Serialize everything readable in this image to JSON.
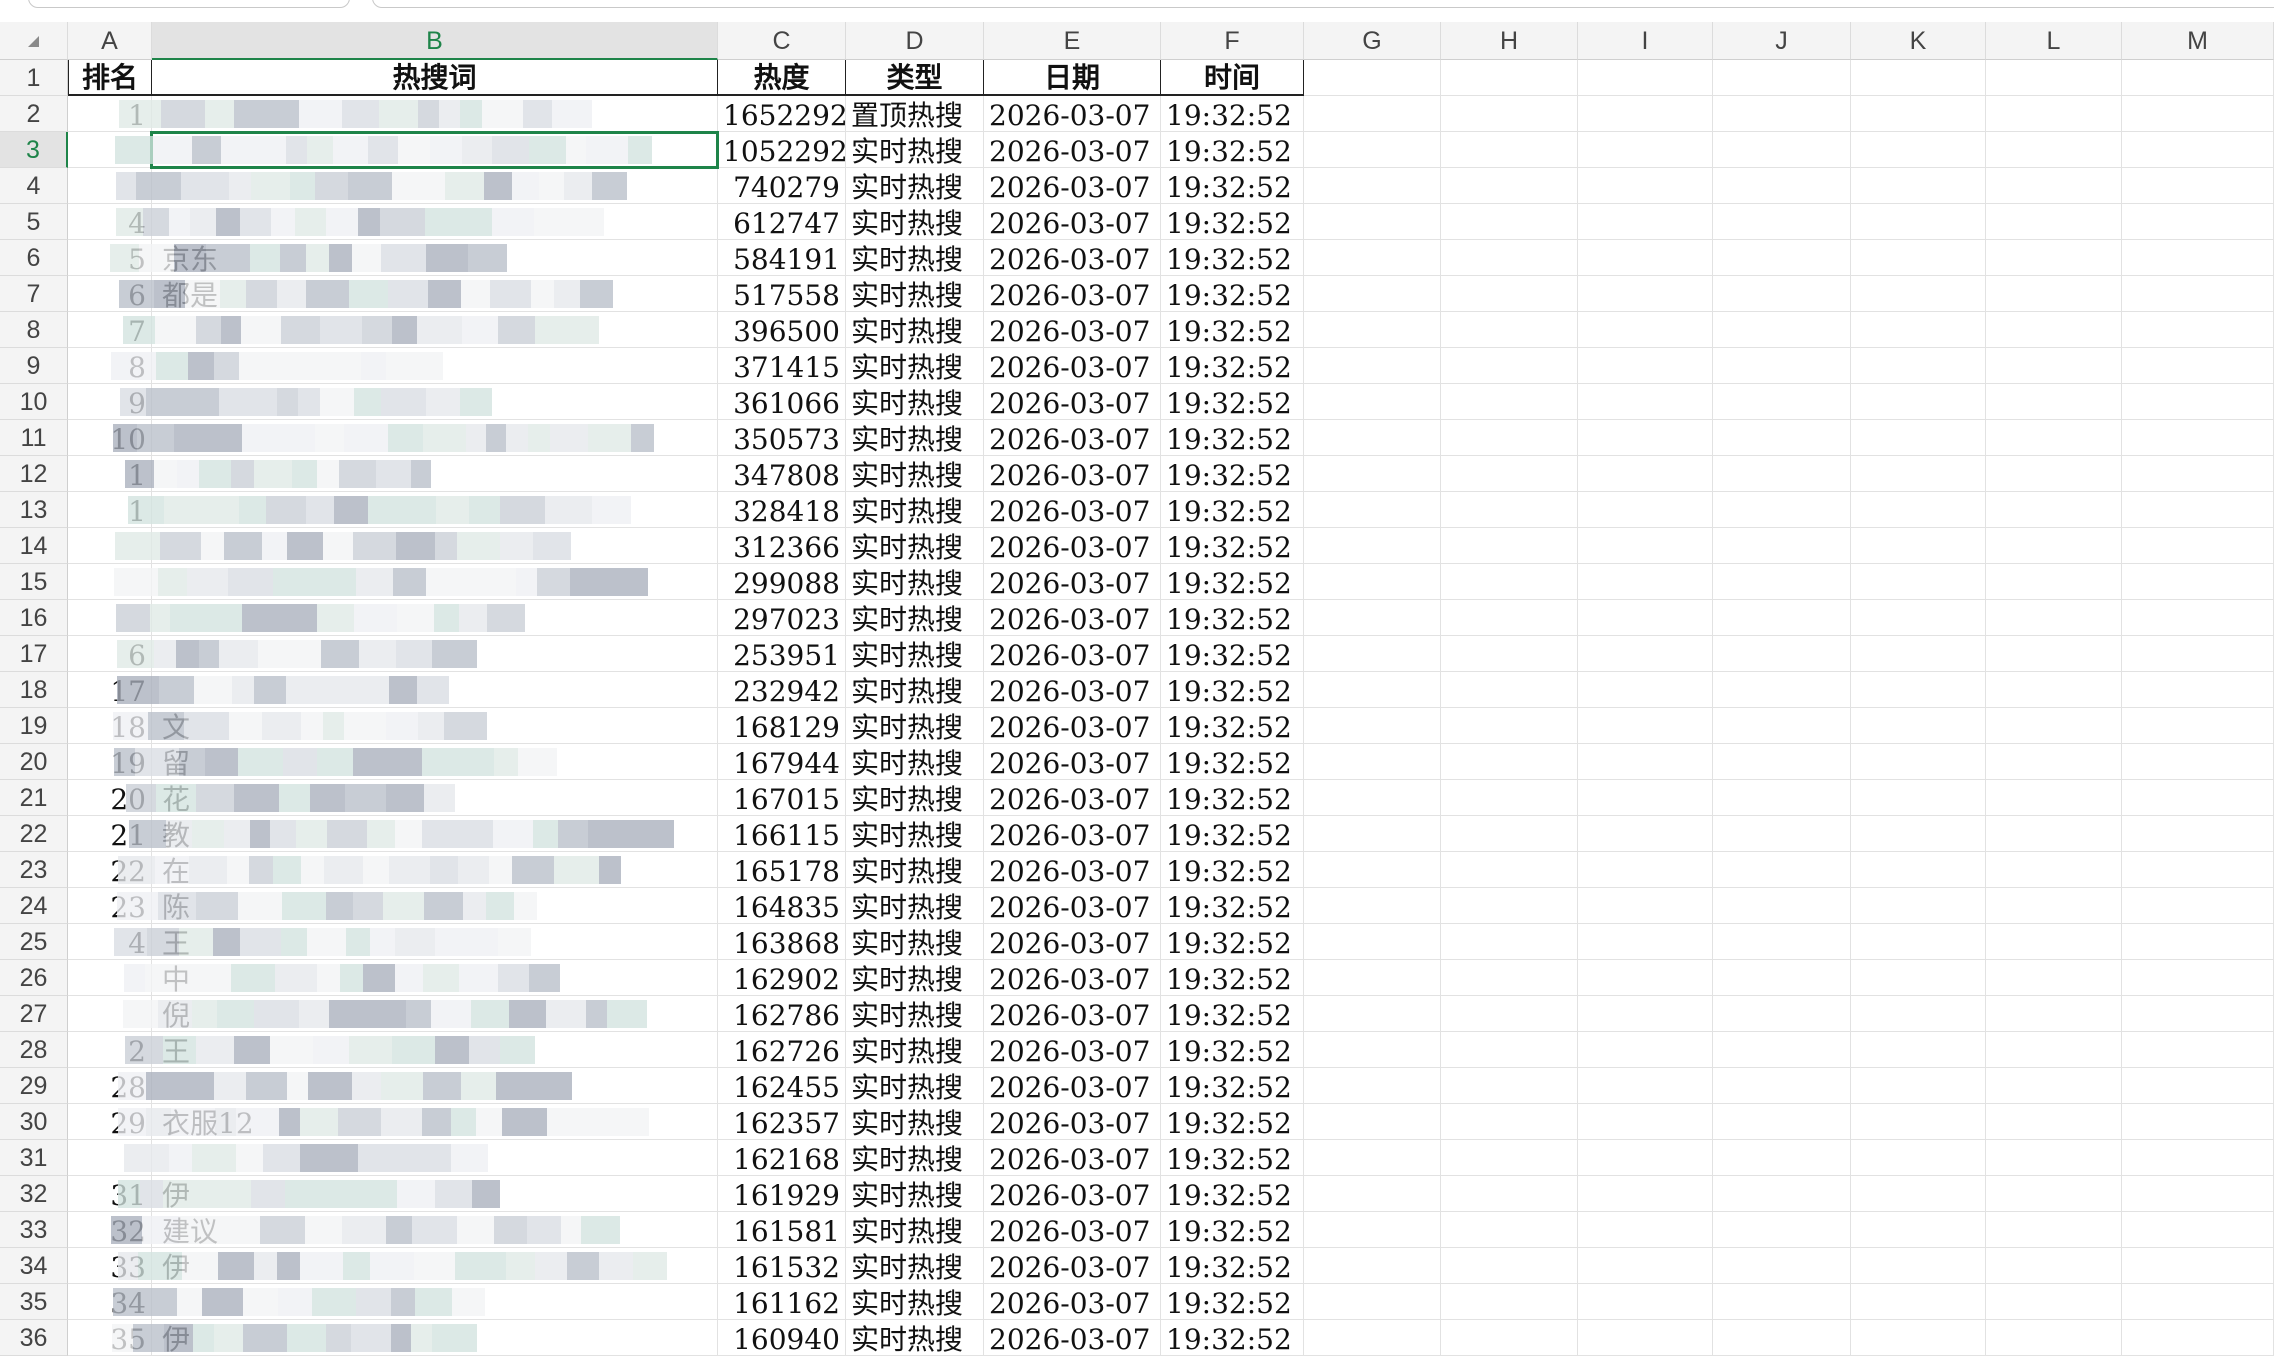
{
  "sheet": {
    "columns": [
      "A",
      "B",
      "C",
      "D",
      "E",
      "F",
      "G",
      "H",
      "I",
      "J",
      "K",
      "L",
      "M"
    ],
    "selected_column": "B",
    "selected_row": "3",
    "header_row": [
      "排名",
      "热搜词",
      "热度",
      "类型",
      "日期",
      "时间"
    ],
    "rows": [
      {
        "rank": "1",
        "keyword": "",
        "heat": "1652292",
        "type": "置顶热搜",
        "date": "2026-03-07",
        "time": "19:32:52"
      },
      {
        "rank": "",
        "keyword": "",
        "heat": "1052292",
        "type": "实时热搜",
        "date": "2026-03-07",
        "time": "19:32:52"
      },
      {
        "rank": "",
        "keyword": "",
        "heat": "740279",
        "type": "实时热搜",
        "date": "2026-03-07",
        "time": "19:32:52"
      },
      {
        "rank": "4",
        "keyword": "",
        "heat": "612747",
        "type": "实时热搜",
        "date": "2026-03-07",
        "time": "19:32:52"
      },
      {
        "rank": "5",
        "keyword": "京东",
        "heat": "584191",
        "type": "实时热搜",
        "date": "2026-03-07",
        "time": "19:32:52"
      },
      {
        "rank": "6",
        "keyword": "都是",
        "heat": "517558",
        "type": "实时热搜",
        "date": "2026-03-07",
        "time": "19:32:52"
      },
      {
        "rank": "7",
        "keyword": "",
        "heat": "396500",
        "type": "实时热搜",
        "date": "2026-03-07",
        "time": "19:32:52"
      },
      {
        "rank": "8",
        "keyword": "",
        "heat": "371415",
        "type": "实时热搜",
        "date": "2026-03-07",
        "time": "19:32:52"
      },
      {
        "rank": "9",
        "keyword": "",
        "heat": "361066",
        "type": "实时热搜",
        "date": "2026-03-07",
        "time": "19:32:52"
      },
      {
        "rank": "10",
        "keyword": "",
        "heat": "350573",
        "type": "实时热搜",
        "date": "2026-03-07",
        "time": "19:32:52"
      },
      {
        "rank": "1",
        "keyword": "",
        "heat": "347808",
        "type": "实时热搜",
        "date": "2026-03-07",
        "time": "19:32:52"
      },
      {
        "rank": "1",
        "keyword": "",
        "heat": "328418",
        "type": "实时热搜",
        "date": "2026-03-07",
        "time": "19:32:52"
      },
      {
        "rank": "",
        "keyword": "",
        "heat": "312366",
        "type": "实时热搜",
        "date": "2026-03-07",
        "time": "19:32:52"
      },
      {
        "rank": "",
        "keyword": "",
        "heat": "299088",
        "type": "实时热搜",
        "date": "2026-03-07",
        "time": "19:32:52"
      },
      {
        "rank": "",
        "keyword": "",
        "heat": "297023",
        "type": "实时热搜",
        "date": "2026-03-07",
        "time": "19:32:52"
      },
      {
        "rank": "6",
        "keyword": "",
        "heat": "253951",
        "type": "实时热搜",
        "date": "2026-03-07",
        "time": "19:32:52"
      },
      {
        "rank": "17",
        "keyword": "",
        "heat": "232942",
        "type": "实时热搜",
        "date": "2026-03-07",
        "time": "19:32:52"
      },
      {
        "rank": "18",
        "keyword": "文",
        "heat": "168129",
        "type": "实时热搜",
        "date": "2026-03-07",
        "time": "19:32:52"
      },
      {
        "rank": "19",
        "keyword": "留",
        "heat": "167944",
        "type": "实时热搜",
        "date": "2026-03-07",
        "time": "19:32:52"
      },
      {
        "rank": "20",
        "keyword": "花",
        "heat": "167015",
        "type": "实时热搜",
        "date": "2026-03-07",
        "time": "19:32:52"
      },
      {
        "rank": "21",
        "keyword": "教",
        "heat": "166115",
        "type": "实时热搜",
        "date": "2026-03-07",
        "time": "19:32:52"
      },
      {
        "rank": "22",
        "keyword": "在",
        "heat": "165178",
        "type": "实时热搜",
        "date": "2026-03-07",
        "time": "19:32:52"
      },
      {
        "rank": "23",
        "keyword": "陈",
        "heat": "164835",
        "type": "实时热搜",
        "date": "2026-03-07",
        "time": "19:32:52"
      },
      {
        "rank": "4",
        "keyword": "王",
        "heat": "163868",
        "type": "实时热搜",
        "date": "2026-03-07",
        "time": "19:32:52"
      },
      {
        "rank": "",
        "keyword": "中",
        "heat": "162902",
        "type": "实时热搜",
        "date": "2026-03-07",
        "time": "19:32:52"
      },
      {
        "rank": "",
        "keyword": "倪",
        "heat": "162786",
        "type": "实时热搜",
        "date": "2026-03-07",
        "time": "19:32:52"
      },
      {
        "rank": "2",
        "keyword": "王",
        "heat": "162726",
        "type": "实时热搜",
        "date": "2026-03-07",
        "time": "19:32:52"
      },
      {
        "rank": "28",
        "keyword": "",
        "heat": "162455",
        "type": "实时热搜",
        "date": "2026-03-07",
        "time": "19:32:52"
      },
      {
        "rank": "29",
        "keyword": "衣服12",
        "heat": "162357",
        "type": "实时热搜",
        "date": "2026-03-07",
        "time": "19:32:52"
      },
      {
        "rank": "",
        "keyword": "",
        "heat": "162168",
        "type": "实时热搜",
        "date": "2026-03-07",
        "time": "19:32:52"
      },
      {
        "rank": "31",
        "keyword": "伊",
        "heat": "161929",
        "type": "实时热搜",
        "date": "2026-03-07",
        "time": "19:32:52"
      },
      {
        "rank": "32",
        "keyword": "建议",
        "heat": "161581",
        "type": "实时热搜",
        "date": "2026-03-07",
        "time": "19:32:52"
      },
      {
        "rank": "33",
        "keyword": "伊",
        "heat": "161532",
        "type": "实时热搜",
        "date": "2026-03-07",
        "time": "19:32:52"
      },
      {
        "rank": "34",
        "keyword": "",
        "heat": "161162",
        "type": "实时热搜",
        "date": "2026-03-07",
        "time": "19:32:52"
      },
      {
        "rank": "35",
        "keyword": "伊",
        "heat": "160940",
        "type": "实时热搜",
        "date": "2026-03-07",
        "time": "19:32:52"
      }
    ]
  },
  "colors": {
    "accent": "#1e8449",
    "header_bg": "#f4f4f4",
    "grid": "#e2e2e2"
  }
}
